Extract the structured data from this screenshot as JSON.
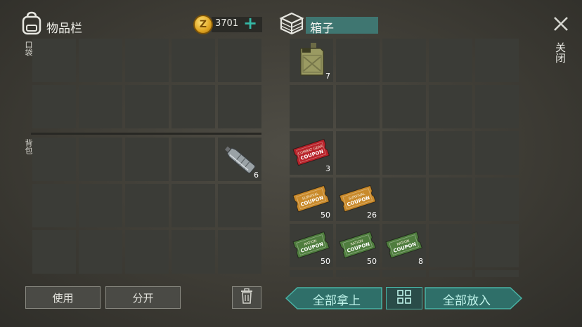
{
  "inventory": {
    "title": "物品栏",
    "icon": "backpack-icon",
    "pocket_label": "口袋",
    "backpack_label": "背包",
    "pocket_slots": [
      null,
      null,
      null,
      null,
      null,
      null,
      null,
      null,
      null,
      null
    ],
    "backpack_slots": [
      null,
      null,
      null,
      null,
      {
        "item": "water-bottle-icon",
        "count": "6"
      },
      null,
      null,
      null,
      null,
      null,
      null,
      null,
      null,
      null,
      null
    ]
  },
  "currency": {
    "icon_letter": "Z",
    "amount": "3701",
    "add_label": "+"
  },
  "container": {
    "title": "箱子",
    "icon": "crate-icon",
    "slots": [
      {
        "item": "jerrycan-icon",
        "count": "7"
      },
      null,
      null,
      null,
      null,
      null,
      null,
      null,
      null,
      null,
      {
        "item": "combat-gear-coupon-icon",
        "count": "3",
        "color": "#b8232a",
        "text1": "COMBAT GEAR",
        "text2": "COUPON"
      },
      null,
      null,
      null,
      null,
      {
        "item": "orange-coupon-icon",
        "count": "50",
        "color": "#c98a2b",
        "text1": "SURVIVAL",
        "text2": "COUPON"
      },
      {
        "item": "orange-coupon-icon",
        "count": "26",
        "color": "#c98a2b",
        "text1": "SURVIVAL",
        "text2": "COUPON"
      },
      null,
      null,
      null,
      {
        "item": "ration-coupon-icon",
        "count": "50",
        "color": "#4f7d3e",
        "text1": "RATION",
        "text2": "COUPON"
      },
      {
        "item": "ration-coupon-icon",
        "count": "50",
        "color": "#4f7d3e",
        "text1": "RATION",
        "text2": "COUPON"
      },
      {
        "item": "ration-coupon-icon",
        "count": "8",
        "color": "#4f7d3e",
        "text1": "RATION",
        "text2": "COUPON"
      },
      null,
      null
    ]
  },
  "close": {
    "label": "关闭"
  },
  "buttons": {
    "use": "使用",
    "split": "分开",
    "take_all": "全部拿上",
    "put_all": "全部放入"
  },
  "colors": {
    "accent": "#35b8a6",
    "panel": "#3b3c37"
  }
}
